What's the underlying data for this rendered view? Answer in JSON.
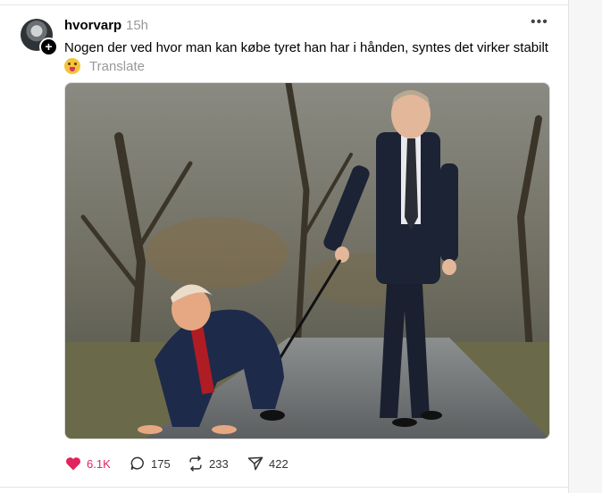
{
  "post": {
    "username": "hvorvarp",
    "timestamp": "15h",
    "more_label": "•••",
    "text": "Nogen der ved hvor man kan købe tyret han har i hånden, syntes det virker stabilt",
    "translate_label": "Translate",
    "media_icon": "photo"
  },
  "actions": {
    "likes": "6.1K",
    "replies": "175",
    "reposts": "233",
    "shares": "422"
  },
  "colors": {
    "like": "#e0245e",
    "muted": "#999999"
  }
}
